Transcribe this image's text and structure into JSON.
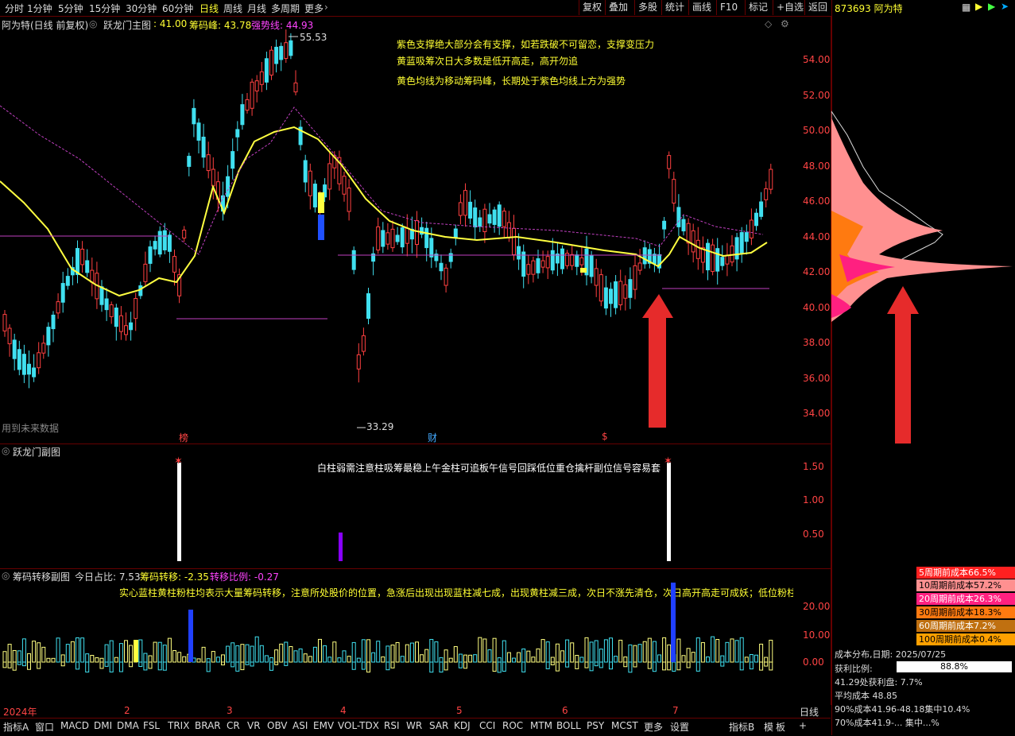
{
  "toolbar": {
    "periods": [
      "分时",
      "1分钟",
      "5分钟",
      "15分钟",
      "30分钟",
      "60分钟",
      "日线",
      "周线",
      "月线",
      "多周期",
      "更多"
    ],
    "active_period": "日线",
    "right_buttons": [
      "复权",
      "叠加",
      "多股",
      "统计",
      "画线",
      "F10",
      "标记",
      "+自选",
      "返回"
    ]
  },
  "stock": {
    "code_name": "873693 阿为特"
  },
  "main_panel": {
    "title": "阿为特(日线 前复权)",
    "indicator": "跃龙门主图",
    "val1": ": 41.00",
    "chips_label": "筹码峰: 43.78",
    "strong_label": "强势线: 44.93",
    "high_mark": "55.53",
    "low_mark": "33.29",
    "future_note": "用到未来数据",
    "annotations": [
      "紫色支撑绝大部分会有支撑，如若跌破不可留恋，支撑变压力",
      "黄蓝吸筹次日大多数是低开高走，高开勿追",
      "黄色均线为移动筹码峰，长期处于紫色均线上方为强势"
    ],
    "markers": [
      "榜",
      "财",
      "$"
    ],
    "y_ticks": [
      "54.00",
      "52.00",
      "50.00",
      "48.00",
      "46.00",
      "44.00",
      "42.00",
      "40.00",
      "38.00",
      "36.00",
      "34.00"
    ]
  },
  "sub1": {
    "title": "跃龙门副图",
    "scroll_text": "白柱弱需注意柱吸筹最稳上午金柱可追板午信号回踩低位重仓擒杆副位信号容易套",
    "y_ticks": [
      "1.50",
      "1.00",
      "0.50"
    ],
    "bar_values": [
      {
        "pos": 0.215,
        "value": 1.55,
        "color": "#ffffff"
      },
      {
        "pos": 0.41,
        "value": 0.45,
        "color": "#8800ff"
      },
      {
        "pos": 0.805,
        "value": 1.55,
        "color": "#ffffff"
      }
    ]
  },
  "sub2": {
    "title": "筹码转移副图",
    "today_ratio": "今日占比: 7.53",
    "transfer": "筹码转移: -2.35",
    "transfer_ratio": "转移比例: -0.27",
    "note": "实心蓝柱黄柱粉柱均表示大量筹码转移，注意所处股价的位置，急涨后出现出现蓝柱减七成，出现黄柱减三成，次日不涨先清仓，次日高开高走可成妖；低位粉柱",
    "y_ticks": [
      "20.00",
      "10.00",
      "0.00"
    ]
  },
  "x_axis": {
    "labels": [
      "2024年",
      "2",
      "3",
      "4",
      "5",
      "6",
      "7"
    ],
    "right_label": "日线"
  },
  "bottom_tabs": [
    "指标A",
    "窗口",
    "MACD",
    "DMI",
    "DMA",
    "FSL",
    "TRIX",
    "BRAR",
    "CR",
    "VR",
    "OBV",
    "ASI",
    "EMV",
    "VOL-TDX",
    "RSI",
    "WR",
    "SAR",
    "KDJ",
    "CCI",
    "ROC",
    "MTM",
    "BOLL",
    "PSY",
    "MCST",
    "更多",
    "设置",
    "指标B",
    "模",
    "板",
    "+"
  ],
  "cost_legend": [
    {
      "label": "5周期前成本66.5%",
      "bg": "#ff2020",
      "fg": "#fff"
    },
    {
      "label": "10周期前成本57.2%",
      "bg": "#ff9090",
      "fg": "#000"
    },
    {
      "label": "20周期前成本26.3%",
      "bg": "#ff2080",
      "fg": "#fff"
    },
    {
      "label": "30周期前成本18.3%",
      "bg": "#ff7a10",
      "fg": "#000"
    },
    {
      "label": "60周期前成本7.2%",
      "bg": "#c07010",
      "fg": "#fff"
    },
    {
      "label": "100周期前成本0.4%",
      "bg": "#ffa000",
      "fg": "#000"
    }
  ],
  "cost_info": {
    "date": "成本分布,日期: 2025/07/25",
    "profit_label": "获利比例:",
    "profit_value": "88.8%",
    "line3": "41.29处获利盘: 7.7%",
    "line4": "平均成本 48.85",
    "line5": "90%成本41.96-48.18集中10.4%",
    "line6": "70%成本41.9-... 集中...%"
  },
  "colors": {
    "up": "#ff4040",
    "down": "#40e0f0",
    "ma_yellow": "#ffff40",
    "ma_purple": "#d040d0",
    "grid_red": "#600000"
  }
}
